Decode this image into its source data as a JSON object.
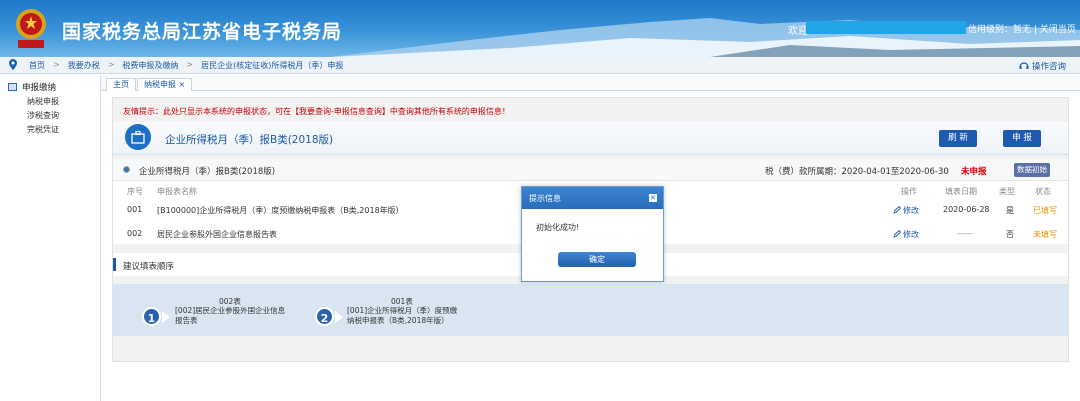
{
  "header": {
    "title": "国家税务总局江苏省电子税务局",
    "welcome": "欢迎",
    "credit": "信用级别：暂无 | 关闭当页"
  },
  "breadcrumb": {
    "items": [
      "首页",
      "我要办税",
      "税费申报及缴纳",
      "居民企业(核定征收)所得税月（季）申报"
    ],
    "separator": ">",
    "help": "操作咨询"
  },
  "sidebar": {
    "title": "申报缴纳",
    "items": [
      "纳税申报",
      "涉税查询",
      "完税凭证"
    ]
  },
  "tabs": [
    {
      "label": "主页"
    },
    {
      "label": "纳税申报 ×"
    }
  ],
  "content": {
    "tip": "友情提示：此处只显示本系统的申报状态，可在【我要查询-申报信息查询】中查询其他所有系统的申报信息！",
    "form_title": "企业所得税月（季）报B类(2018版)",
    "buttons": {
      "refresh": "刷 新",
      "declare": "申 报"
    },
    "period_name": "企业所得税月（季）报B类(2018版)",
    "period_text": "税（费）款所属期：2020-04-01至2020-06-30",
    "status": "未申报",
    "init_button": "数据初始化",
    "columns": [
      "序号",
      "申报表名称",
      "操作",
      "填表日期",
      "类型",
      "状态"
    ],
    "rows": [
      {
        "no": "001",
        "name": "[B100000]企业所得税月（季）度预缴纳税申报表（B类,2018年版）",
        "action": "修改",
        "date": "2020-06-28",
        "type": "是",
        "state": "已填写"
      },
      {
        "no": "002",
        "name": "居民企业参股外国企业信息报告表",
        "action": "修改",
        "date": "——",
        "type": "否",
        "state": "未填写"
      }
    ],
    "suggest_title": "建议填表顺序",
    "steps": [
      {
        "num": "1",
        "code": "002表",
        "text": "[002]居民企业参股外国企业信息报告表"
      },
      {
        "num": "2",
        "code": "001表",
        "text": "[001]企业所得税月（季）度预缴纳税申报表（B类,2018年版）"
      }
    ]
  },
  "modal": {
    "title": "提示信息",
    "message": "初始化成功!",
    "ok": "确定"
  },
  "colors": {
    "header": "#1d78c8",
    "primary": "#1d5bb2",
    "warn": "#d00",
    "pending": "#e69500"
  }
}
